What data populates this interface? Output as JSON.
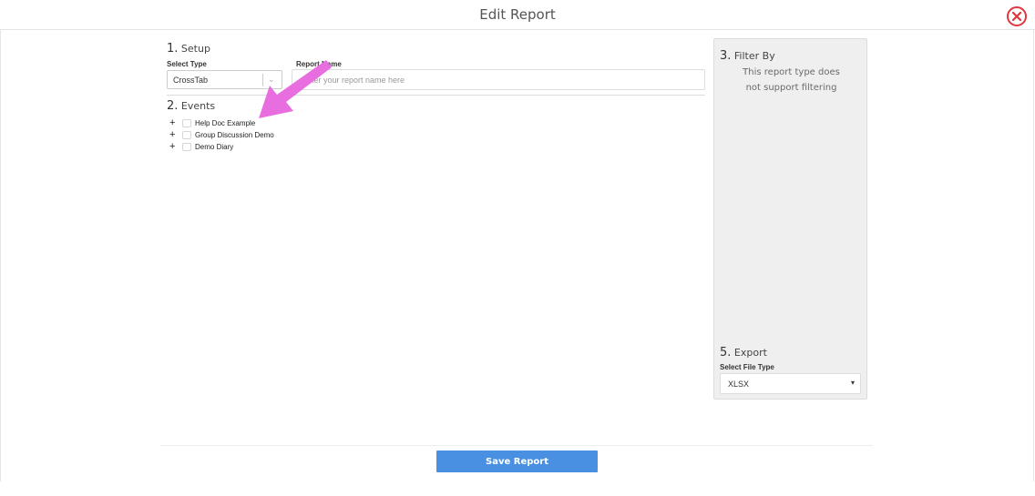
{
  "header": {
    "title": "Edit Report"
  },
  "setup": {
    "number": "1.",
    "title": "Setup",
    "select_type_label": "Select Type",
    "select_type_value": "CrossTab",
    "report_name_label": "Report Name",
    "report_name_placeholder": "Enter your report name here"
  },
  "events": {
    "number": "2.",
    "title": "Events",
    "items": [
      {
        "label": "Help Doc Example"
      },
      {
        "label": "Group Discussion Demo"
      },
      {
        "label": "Demo Diary"
      }
    ]
  },
  "filter": {
    "number": "3.",
    "title": "Filter By",
    "note_line1": "This report type does",
    "note_line2": "not support filtering"
  },
  "export": {
    "number": "5.",
    "title": "Export",
    "file_type_label": "Select File Type",
    "file_type_value": "XLSX"
  },
  "footer": {
    "save_label": "Save Report"
  },
  "colors": {
    "accent": "#4a90e2",
    "close": "#e0363c",
    "annotation_arrow": "#e86ee0"
  }
}
